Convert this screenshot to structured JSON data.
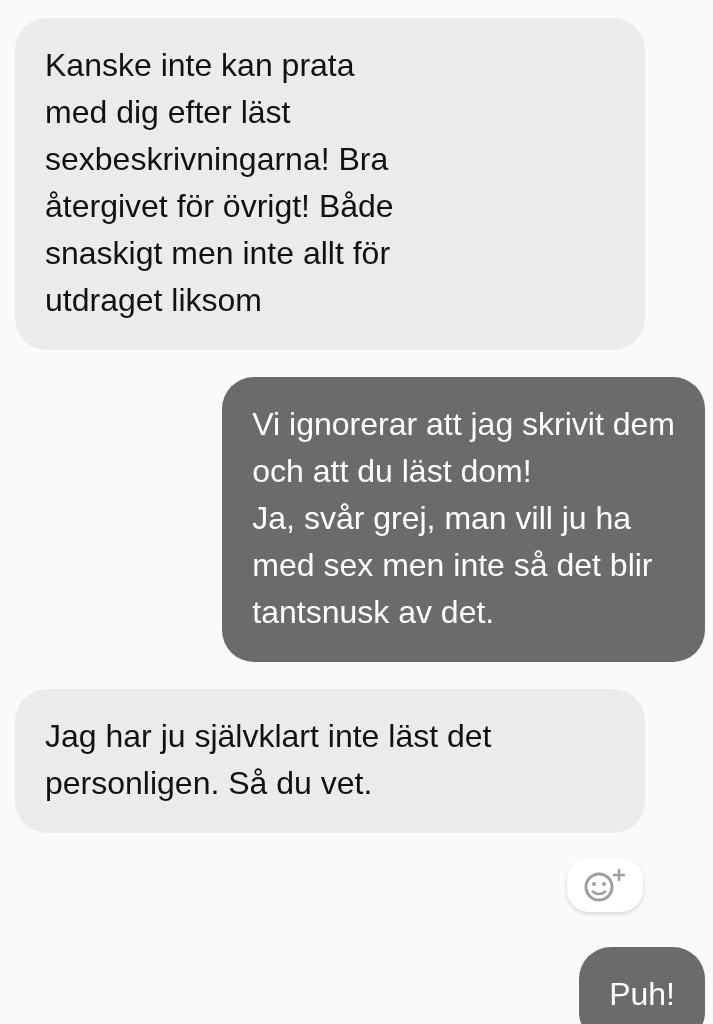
{
  "messages": [
    {
      "kind": "received",
      "text": "Kanske inte kan prata\nmed dig efter läst\nsexbeskrivningarna! Bra\nåtergivet för övrigt! Både\nsnaskigt men inte allt för\nutdraget liksom"
    },
    {
      "kind": "sent",
      "text": "Vi ignorerar att jag skrivit dem\noch att du läst dom!\nJa, svår grej, man vill ju ha\nmed sex men inte så det blir\ntantsnusk av det."
    },
    {
      "kind": "received",
      "text": "Jag har ju självklart inte läst det\npersonligen. Så du vet."
    },
    {
      "kind": "reaction"
    },
    {
      "kind": "sent",
      "text": "Puh!"
    }
  ]
}
